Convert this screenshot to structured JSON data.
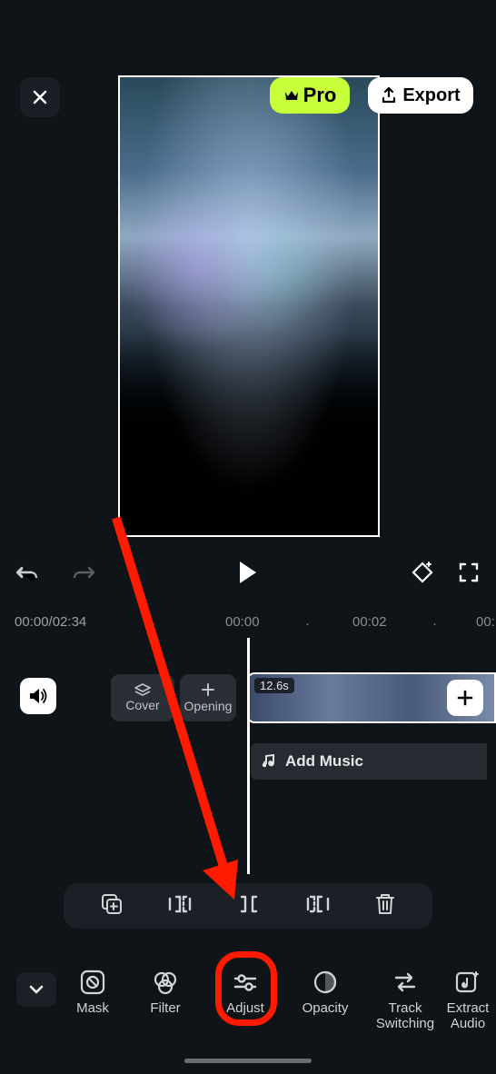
{
  "header": {
    "pro_label": "Pro",
    "export_label": "Export"
  },
  "playback": {
    "current_time": "00:00",
    "total_time": "02:34"
  },
  "ruler": {
    "tick0": "00:00",
    "tick1": "00:02",
    "tick2": "00:"
  },
  "timeline": {
    "cover_label": "Cover",
    "opening_label": "Opening",
    "clip_duration": "12.6s",
    "add_music_label": "Add Music"
  },
  "bottom_nav": {
    "items": [
      {
        "label": "Mask"
      },
      {
        "label": "Filter"
      },
      {
        "label": "Adjust"
      },
      {
        "label": "Opacity"
      },
      {
        "label": "Track\nSwitching"
      },
      {
        "label": "Extract\nAudio"
      }
    ]
  },
  "colors": {
    "accent": "#c7ff3a",
    "highlight": "#ff1a00"
  }
}
